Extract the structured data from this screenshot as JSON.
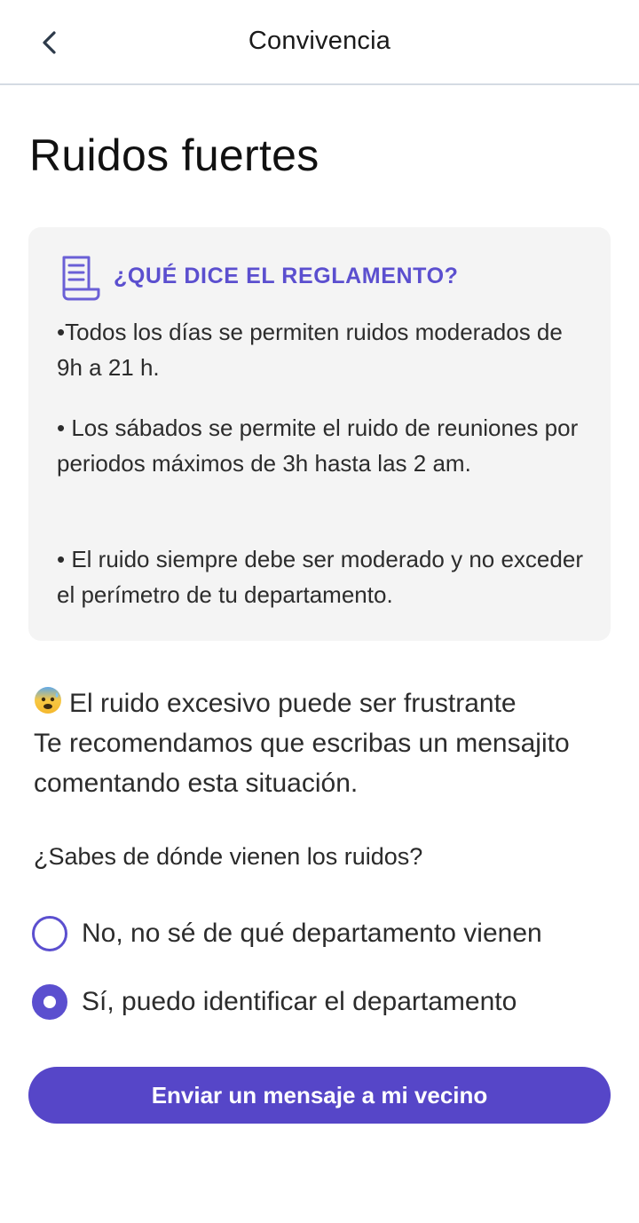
{
  "header": {
    "title": "Convivencia",
    "back_icon": "chevron-left-icon"
  },
  "page": {
    "title": "Ruidos fuertes"
  },
  "rules_card": {
    "icon": "document-scroll-icon",
    "heading": "¿QUÉ DICE EL REGLAMENTO?",
    "rules": [
      "•Todos los días se permiten ruidos moderados de 9h a 21 h.",
      "• Los sábados se permite el ruido de reuniones por periodos máximos de 3h hasta las 2 am.",
      "• El ruido siempre debe ser moderado y no exceder el perímetro de tu departamento."
    ]
  },
  "info": {
    "emoji": "anxious-face-with-sweat-icon",
    "line1": "El ruido excesivo puede ser frustrante",
    "line2": "Te recomendamos que escribas un mensajito comentando esta situación."
  },
  "question": {
    "label": "¿Sabes de dónde vienen los ruidos?",
    "options": [
      {
        "label": "No, no sé de qué departamento vienen",
        "selected": false
      },
      {
        "label": "Sí, puedo identificar el departamento",
        "selected": true
      }
    ]
  },
  "cta": {
    "label": "Enviar un mensaje a mi vecino"
  },
  "colors": {
    "accent": "#5b4fcf",
    "button": "#5646c8",
    "card_bg": "#f4f4f4"
  }
}
